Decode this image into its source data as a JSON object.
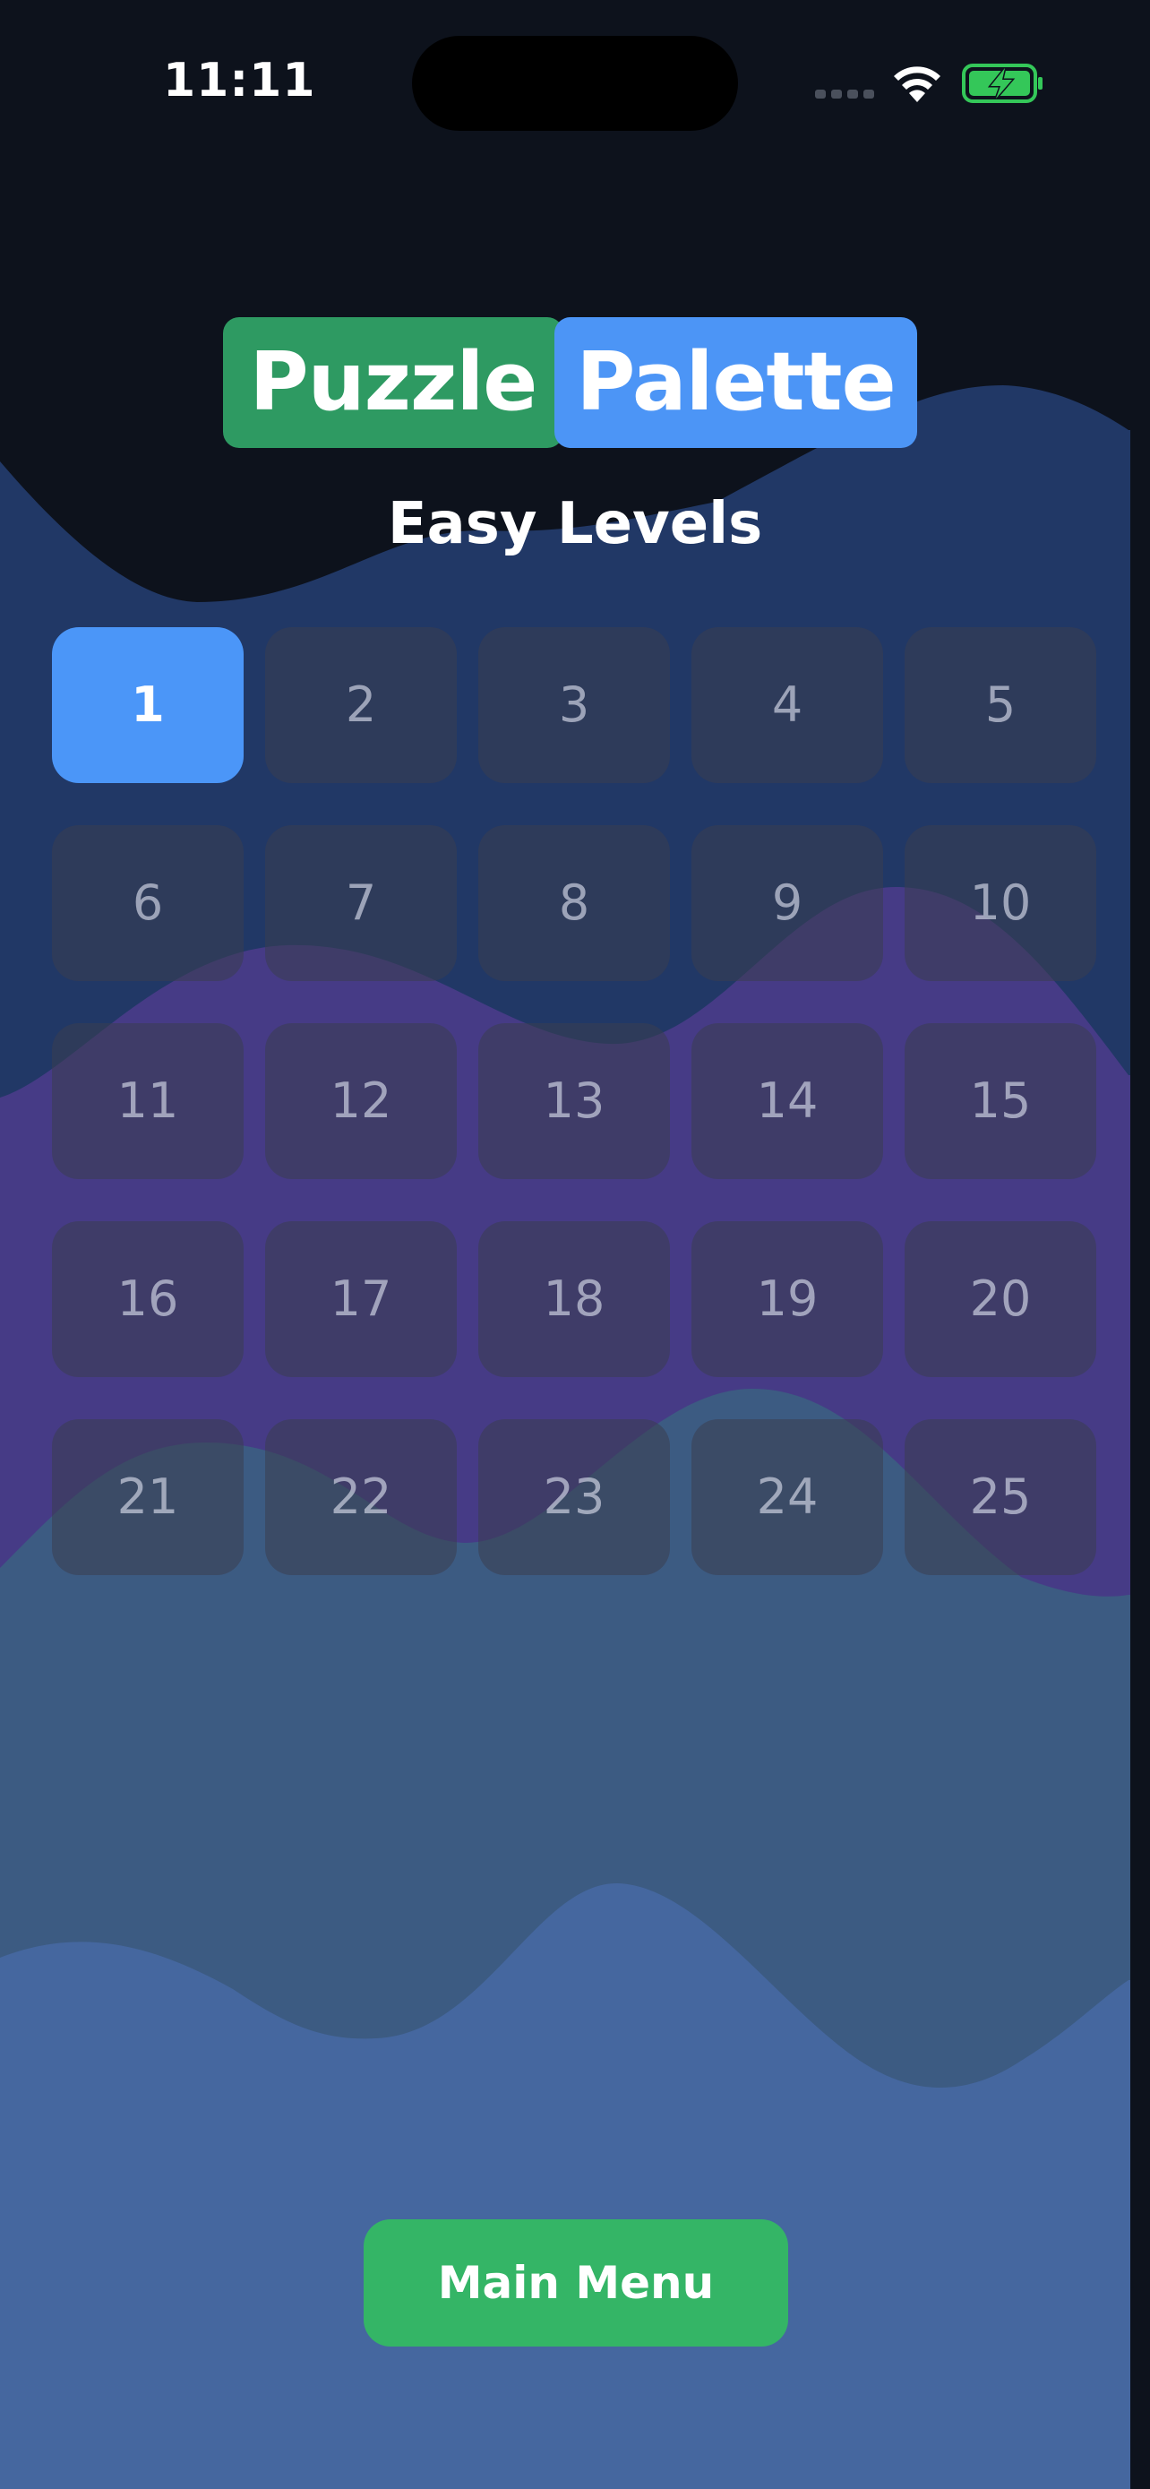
{
  "status_bar": {
    "time": "11:11",
    "icons": [
      "signal-dots-icon",
      "wifi-icon",
      "battery-charging-icon"
    ]
  },
  "title": {
    "word1": "Puzzle",
    "word2": "Palette",
    "word1_color": "#2e9a62",
    "word2_color": "#4c95f6"
  },
  "subtitle": "Easy Levels",
  "levels": {
    "selected": "1",
    "items": [
      "1",
      "2",
      "3",
      "4",
      "5",
      "6",
      "7",
      "8",
      "9",
      "10",
      "11",
      "12",
      "13",
      "14",
      "15",
      "16",
      "17",
      "18",
      "19",
      "20",
      "21",
      "22",
      "23",
      "24",
      "25"
    ]
  },
  "main_menu": {
    "label": "Main Menu",
    "color": "#34b566"
  },
  "colors": {
    "background": "#0d121c",
    "wave_navy": "#213866",
    "wave_purple": "#463b86",
    "wave_slate": "#3c5b82",
    "wave_blue": "#45679f",
    "accent_blue": "#4b96f8"
  }
}
